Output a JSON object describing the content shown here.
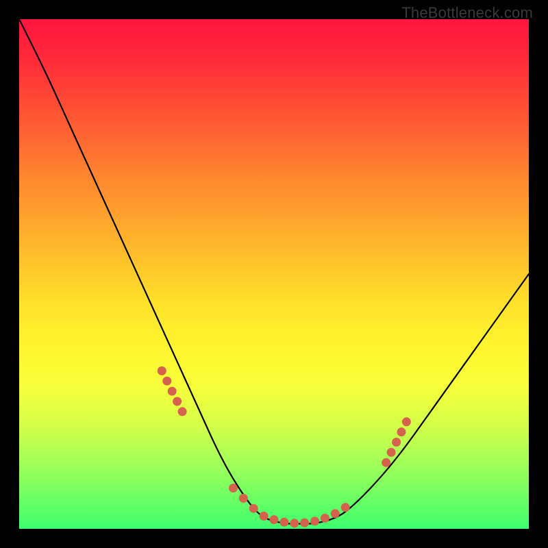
{
  "watermark": "TheBottleneck.com",
  "chart_data": {
    "type": "line",
    "title": "",
    "xlabel": "",
    "ylabel": "",
    "xlim": [
      0,
      100
    ],
    "ylim": [
      0,
      100
    ],
    "series": [
      {
        "name": "bottleneck-curve",
        "x": [
          0,
          5,
          10,
          15,
          20,
          25,
          30,
          35,
          40,
          45,
          48,
          52,
          55,
          58,
          62,
          65,
          70,
          75,
          80,
          85,
          90,
          95,
          100
        ],
        "y": [
          100,
          90,
          79,
          68,
          57,
          46,
          35,
          24,
          13,
          5,
          2,
          1,
          1,
          1,
          2,
          4,
          9,
          15,
          22,
          29,
          36,
          43,
          50
        ]
      }
    ],
    "markers": {
      "name": "highlight-dots",
      "color": "#d5624c",
      "points": [
        {
          "x": 28,
          "y": 31
        },
        {
          "x": 29,
          "y": 29
        },
        {
          "x": 30,
          "y": 27
        },
        {
          "x": 31,
          "y": 25
        },
        {
          "x": 32,
          "y": 23
        },
        {
          "x": 42,
          "y": 8
        },
        {
          "x": 44,
          "y": 6
        },
        {
          "x": 46,
          "y": 4
        },
        {
          "x": 48,
          "y": 2.5
        },
        {
          "x": 50,
          "y": 1.8
        },
        {
          "x": 52,
          "y": 1.3
        },
        {
          "x": 54,
          "y": 1.1
        },
        {
          "x": 56,
          "y": 1.2
        },
        {
          "x": 58,
          "y": 1.5
        },
        {
          "x": 60,
          "y": 2.1
        },
        {
          "x": 62,
          "y": 3.0
        },
        {
          "x": 64,
          "y": 4.2
        },
        {
          "x": 72,
          "y": 13
        },
        {
          "x": 73,
          "y": 15
        },
        {
          "x": 74,
          "y": 17
        },
        {
          "x": 75,
          "y": 19
        },
        {
          "x": 76,
          "y": 21
        }
      ]
    }
  }
}
